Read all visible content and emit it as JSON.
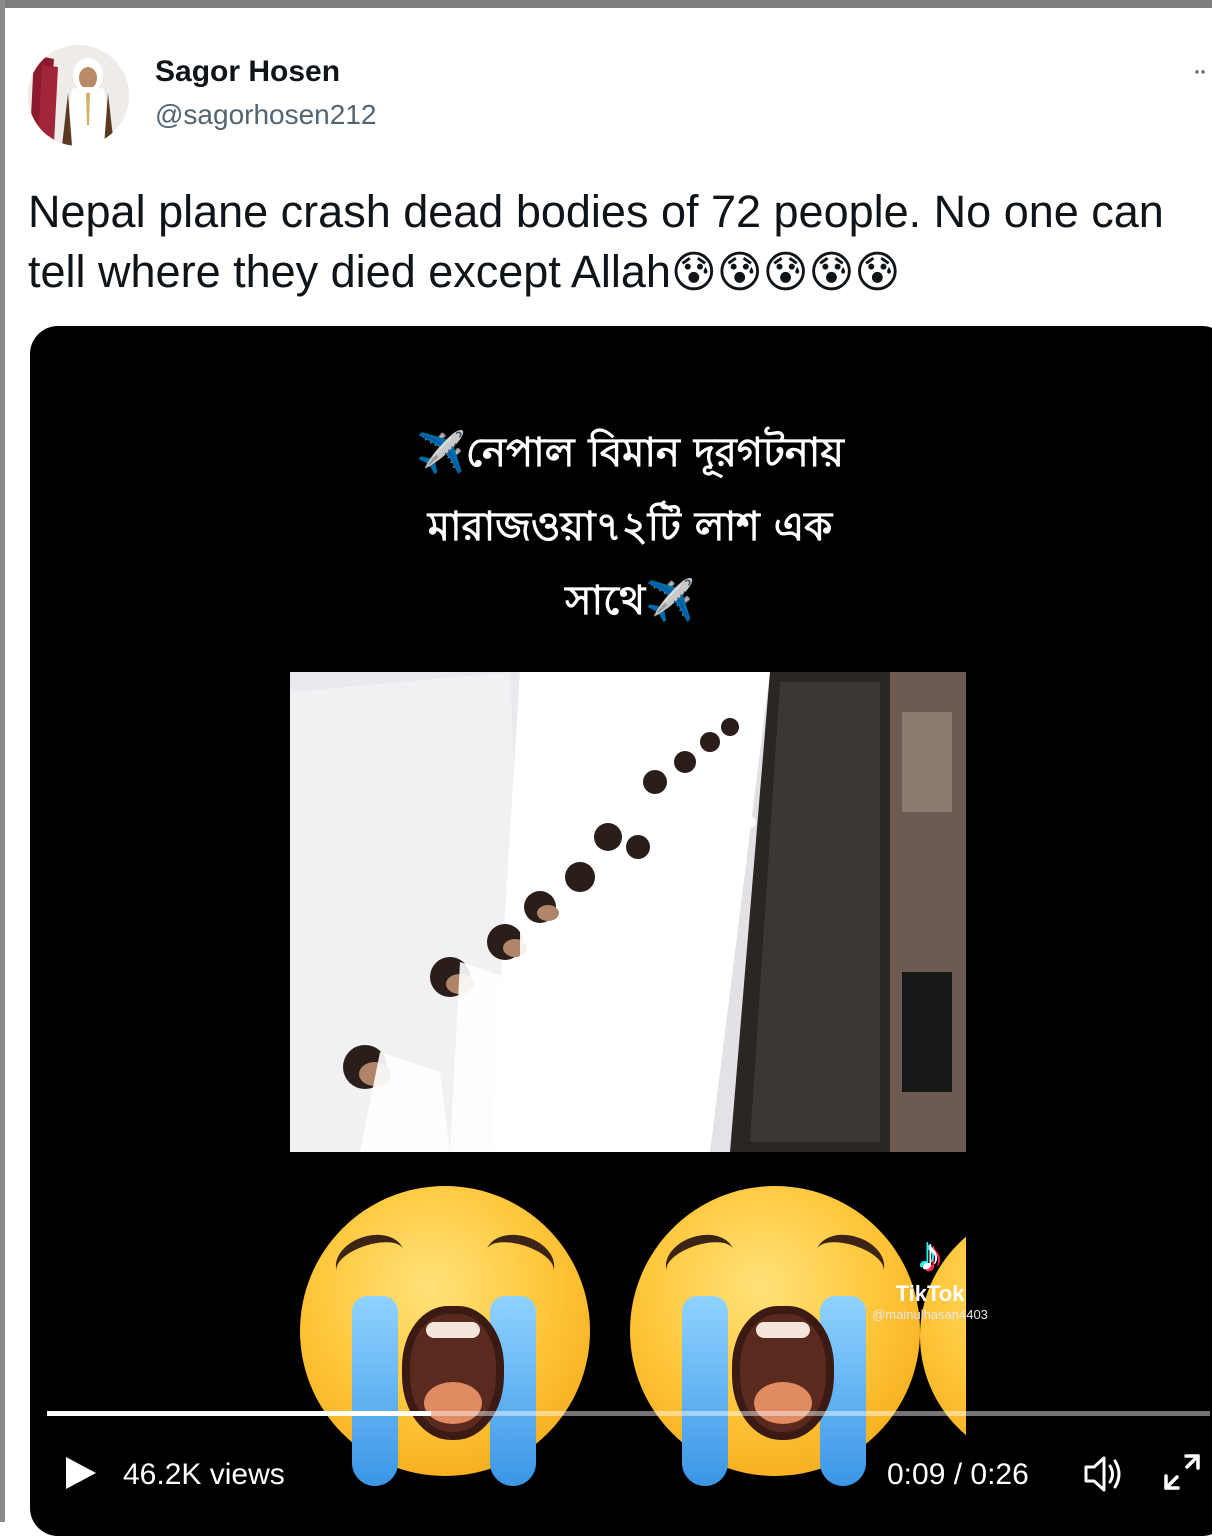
{
  "author": {
    "name": "Sagor Hosen",
    "handle": "@sagorhosen212",
    "avatar_icon": "profile-photo"
  },
  "tweet": {
    "text": "Nepal plane crash dead bodies of 72 people. No one can tell where they died except Allah",
    "emojis": [
      "😰",
      "😰",
      "😰",
      "😰",
      "😰"
    ]
  },
  "video": {
    "caption_lines": [
      "✈️নেপাল বিমান দূরগটনায়",
      "মারাজওয়া৭২টি লাশ এক",
      "সাথে✈️"
    ],
    "watermark_brand": "TikTok",
    "watermark_user": "@mainulhasan4403",
    "views": "46.2K views",
    "time": "0:09 / 0:26",
    "progress": 0.33
  },
  "colors": {
    "handle": "#536471",
    "text": "#0f1419",
    "media_bg": "#000000"
  }
}
